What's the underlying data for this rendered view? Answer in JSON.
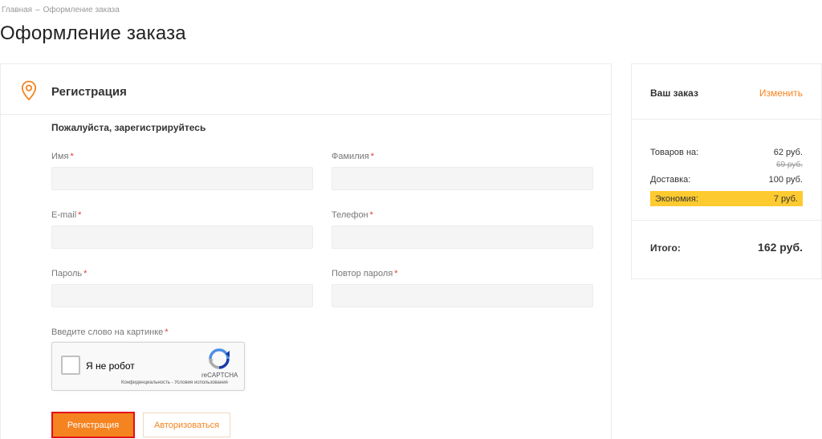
{
  "breadcrumb": {
    "home": "Главная",
    "separator": "–",
    "current": "Оформление заказа"
  },
  "page_title": "Оформление заказа",
  "registration": {
    "title": "Регистрация",
    "subtitle": "Пожалуйста, зарегистрируйтесь",
    "required_mark": "*",
    "fields": {
      "first_name": {
        "label": "Имя",
        "value": ""
      },
      "last_name": {
        "label": "Фамилия",
        "value": ""
      },
      "email": {
        "label": "E-mail",
        "value": ""
      },
      "phone": {
        "label": "Телефон",
        "value": ""
      },
      "password": {
        "label": "Пароль",
        "value": ""
      },
      "password_repeat": {
        "label": "Повтор пароля",
        "value": ""
      }
    },
    "captcha": {
      "label": "Введите слово на картинке",
      "checkbox_label": "Я не робот",
      "brand": "reCAPTCHA",
      "links": "Конфиденциальность - Условия использования"
    },
    "buttons": {
      "register": "Регистрация",
      "login": "Авторизоваться"
    }
  },
  "order": {
    "title": "Ваш заказ",
    "edit": "Изменить",
    "goods_label": "Товаров на:",
    "goods_value": "62 руб.",
    "goods_old_value": "69 руб.",
    "delivery_label": "Доставка:",
    "delivery_value": "100 руб.",
    "economy_label": "Экономия:",
    "economy_value": "7 руб.",
    "total_label": "Итого:",
    "total_value": "162 руб."
  },
  "colors": {
    "accent": "#f5831f",
    "required": "#e03b2b",
    "economy_bg": "#fdca30",
    "highlight_border": "#e0101b"
  },
  "icons": {
    "section": "map-pin-icon",
    "captcha": "recaptcha-logo-icon"
  }
}
